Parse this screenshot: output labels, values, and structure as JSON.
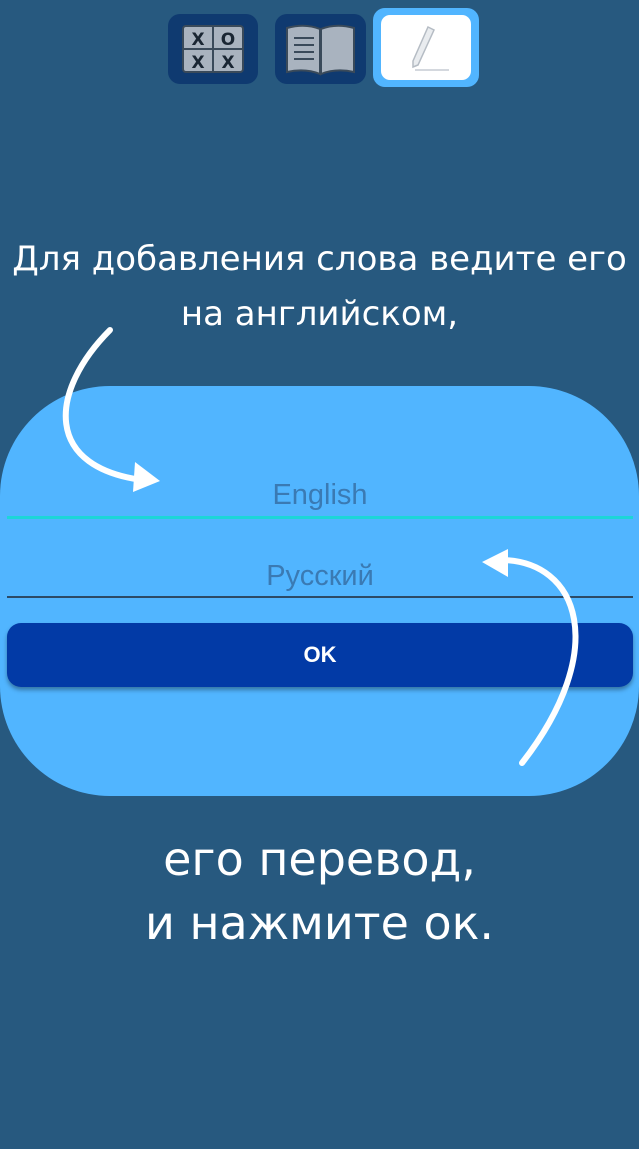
{
  "tabs": [
    {
      "name": "tic-tac-toe",
      "icon": "tic-tac-toe-icon",
      "glyphs": [
        "X",
        "O",
        "X",
        "X"
      ]
    },
    {
      "name": "dictionary",
      "icon": "book-icon"
    },
    {
      "name": "add-word",
      "icon": "pencil-icon",
      "active": true
    }
  ],
  "hint_top": {
    "line1": "Для добавления слова ведите его",
    "line2": "на английском,"
  },
  "form": {
    "english_placeholder": "English",
    "russian_placeholder": "Русский",
    "ok_label": "OK"
  },
  "hint_bottom": {
    "line1": "его перевод,",
    "line2": "и нажмите ок."
  },
  "colors": {
    "background": "#27597f",
    "card": "#51b5ff",
    "button": "#023aa6",
    "active_underline": "#1cd6d8",
    "tab": "#0f3a70"
  }
}
